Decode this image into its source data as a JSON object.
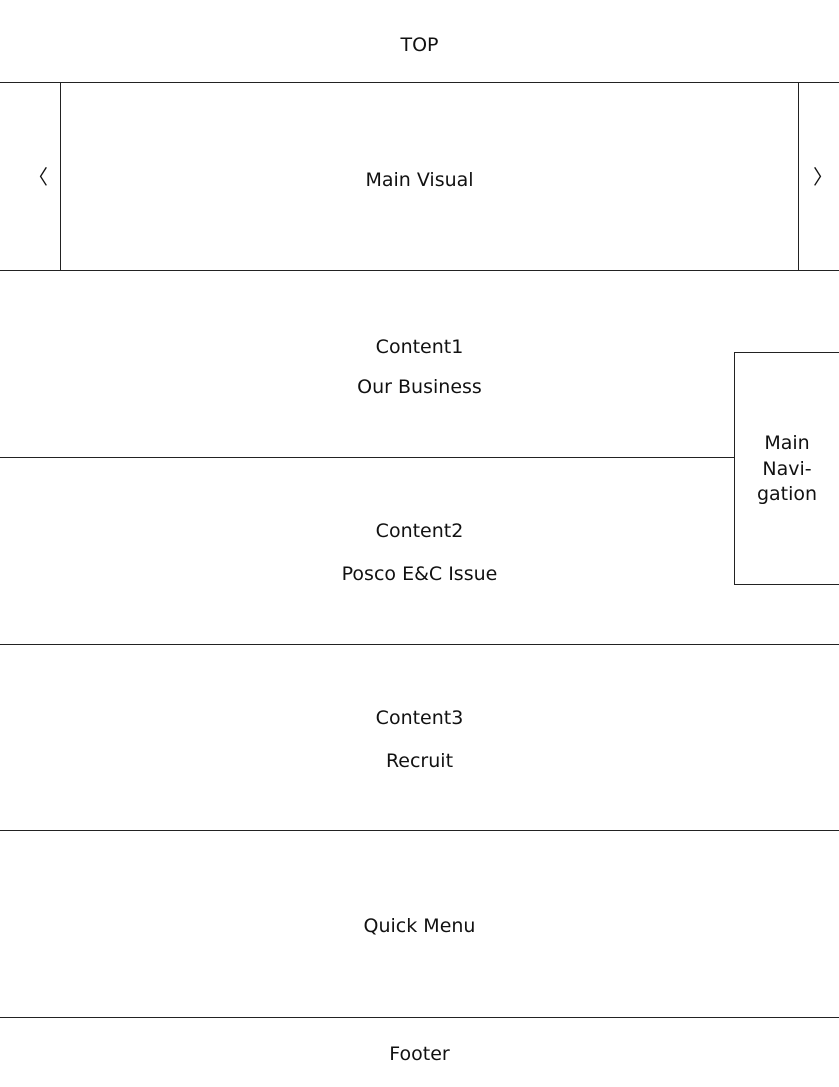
{
  "top": {
    "label": "TOP"
  },
  "main_visual": {
    "label": "Main Visual",
    "prev_arrow": "〈",
    "next_arrow": "〉"
  },
  "content1": {
    "title": "Content1",
    "subtitle": "Our Business"
  },
  "content2": {
    "title": "Content2",
    "subtitle": "Posco E&C Issue"
  },
  "content3": {
    "title": "Content3",
    "subtitle": "Recruit"
  },
  "quick_menu": {
    "label": "Quick Menu"
  },
  "footer": {
    "label": "Footer"
  },
  "main_navigation": {
    "line1": "Main",
    "line2": "Navi-",
    "line3": "gation"
  }
}
